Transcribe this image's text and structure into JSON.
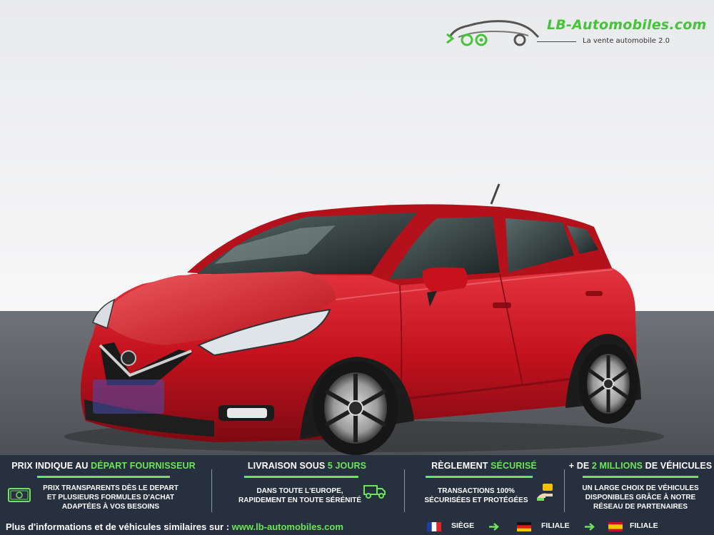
{
  "brand": {
    "name": "LB-Automobiles.com",
    "tagline": "La vente automobile 2.0",
    "accent_color": "#6fe35a"
  },
  "features": [
    {
      "title_prefix": "PRIX INDIQUE AU ",
      "title_highlight": "DÉPART FOURNISSEUR",
      "title_suffix": "",
      "lines": [
        "PRIX TRANSPARENTS DÈS LE DEPART",
        "ET PLUSIEURS FORMULES D'ACHAT",
        "ADAPTÉES À VOS BESOINS"
      ],
      "icon": "money-icon"
    },
    {
      "title_prefix": "LIVRAISON SOUS ",
      "title_highlight": "5 JOURS",
      "title_suffix": "",
      "lines": [
        "DANS TOUTE L'EUROPE,",
        "RAPIDEMENT EN TOUTE SÉRÉNITÉ"
      ],
      "icon": "delivery-truck-icon"
    },
    {
      "title_prefix": "RÈGLEMENT ",
      "title_highlight": "SÉCURISÉ",
      "title_suffix": "",
      "lines": [
        "TRANSACTIONS 100%",
        "SÉCURISÉES ET PROTÉGÉES"
      ],
      "icon": "secure-payment-icon"
    },
    {
      "title_prefix": "+ DE ",
      "title_highlight": "2 MILLIONS",
      "title_suffix": " DE VÉHICULES",
      "lines": [
        "UN LARGE CHOIX DE VÉHICULES",
        "DISPONIBLES GRÂCE À NOTRE",
        "RÉSEAU DE PARTENAIRES"
      ],
      "icon": ""
    }
  ],
  "footer": {
    "text": "Plus d'informations et de véhicules similaires sur : ",
    "url": "www.lb-automobiles.com",
    "locations": [
      {
        "flag": "france-flag-icon",
        "label": "SIÈGE"
      },
      {
        "flag": "germany-flag-icon",
        "label": "FILIALE"
      },
      {
        "flag": "spain-flag-icon",
        "label": "FILIALE"
      }
    ]
  }
}
